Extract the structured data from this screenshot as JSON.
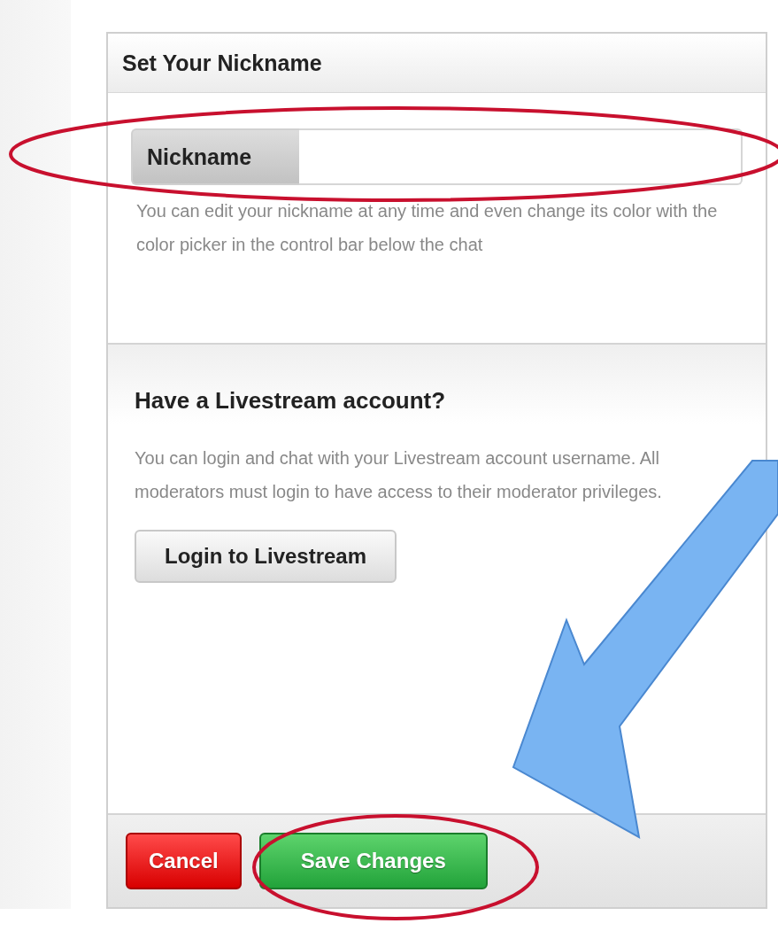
{
  "dialog": {
    "title": "Set Your Nickname",
    "nickname_field": {
      "label": "Nickname"
    },
    "nickname_help": "You can edit your nickname at any time and even change its color with the color picker in the control bar below the chat",
    "account_section": {
      "heading": "Have a Livestream account?",
      "text": "You can login and chat with your Livestream account username. All moderators must login to have access to their moderator privileges.",
      "button": "Login to Livestream"
    },
    "buttons": [
      {
        "kind": "cancel",
        "label": "Cancel"
      },
      {
        "kind": "save",
        "label": "Save Changes"
      }
    ]
  }
}
